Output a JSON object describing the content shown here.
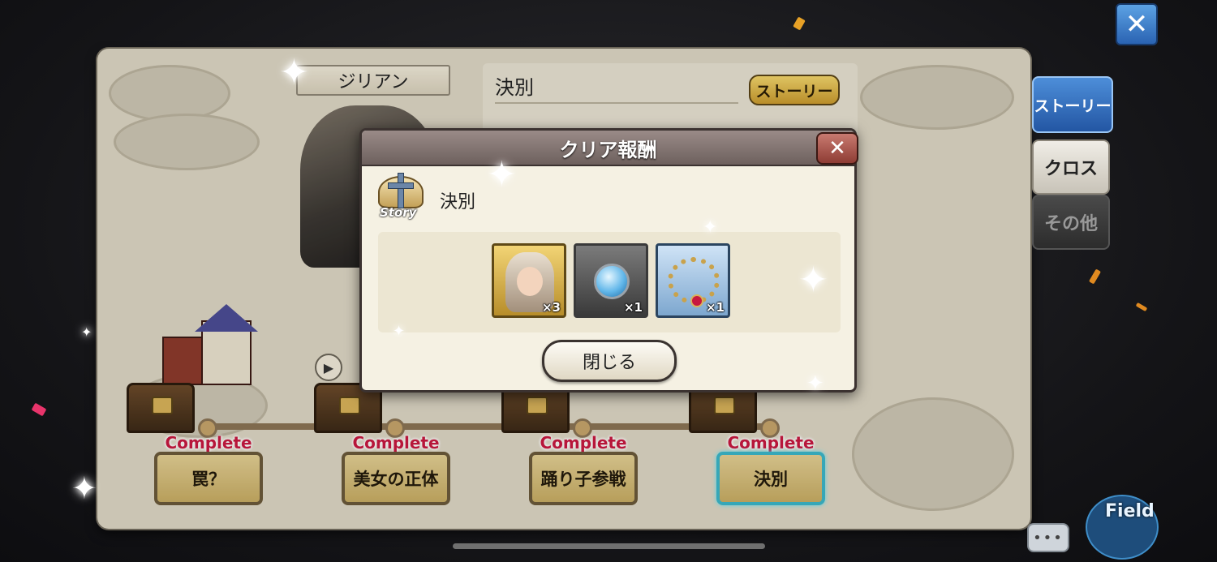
{
  "top_close": {
    "icon": "close-icon",
    "glyph": "✕"
  },
  "board": {
    "character_name": "ジリアン",
    "story_title": "決別",
    "story_badge": "ストーリー",
    "film_glyph": "▶",
    "chapters": [
      {
        "status": "Complete",
        "label": "罠？"
      },
      {
        "status": "Complete",
        "label": "美女の正体"
      },
      {
        "status": "Complete",
        "label": "踊り子参戦"
      },
      {
        "status": "Complete",
        "label": "決別",
        "selected": true
      }
    ]
  },
  "side_tabs": [
    {
      "label": "ストーリー",
      "active": true
    },
    {
      "label": "クロス",
      "active": false
    },
    {
      "label": "その他",
      "active": false
    }
  ],
  "modal": {
    "title": "クリア報酬",
    "close_glyph": "✕",
    "story_icon_label": "Story",
    "subtitle": "決別",
    "rewards": [
      {
        "type": "character-portrait",
        "quantity": "×3"
      },
      {
        "type": "water-orb",
        "quantity": "×1"
      },
      {
        "type": "jewel-necklace",
        "quantity": "×1"
      }
    ],
    "close_button": "閉じる"
  },
  "field_button": {
    "label": "Field"
  },
  "chat_button": {
    "glyph": "•••"
  },
  "colors": {
    "complete_text": "#c7183f",
    "tab_active": "#2e6bbf",
    "selected_outline": "#3bb6c8"
  }
}
